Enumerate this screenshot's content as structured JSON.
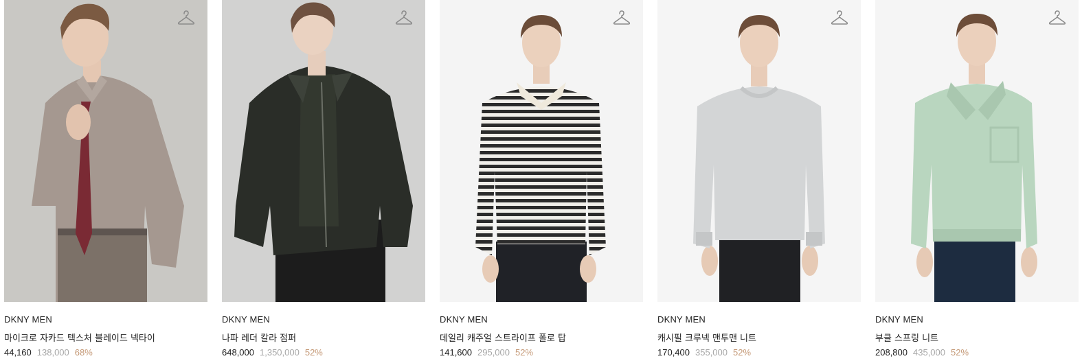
{
  "products": [
    {
      "brand": "DKNY MEN",
      "name": "마이크로 자카드 텍스처 블레이드 넥타이",
      "price": "44,160",
      "original_price": "138,000",
      "discount": "68%",
      "icon": "hanger-icon",
      "colors": {
        "background": "#c9c8c4",
        "garment": "#a59890",
        "pants": "#7c7168",
        "accent": "#7a2a34"
      }
    },
    {
      "brand": "DKNY MEN",
      "name": "나파 레더 칼라 점퍼",
      "price": "648,000",
      "original_price": "1,350,000",
      "discount": "52%",
      "icon": "hanger-icon",
      "colors": {
        "background": "#d2d2d1",
        "garment": "#2a2d28",
        "pants": "#1c1c1c",
        "accent": "#33382f"
      }
    },
    {
      "brand": "DKNY MEN",
      "name": "데일리 캐주얼 스트라이프 폴로 탑",
      "price": "141,600",
      "original_price": "295,000",
      "discount": "52%",
      "icon": "hanger-icon",
      "colors": {
        "background": "#f4f4f4",
        "garment": "#2b2b2b",
        "pants": "#202227",
        "accent": "#efe9dc"
      }
    },
    {
      "brand": "DKNY MEN",
      "name": "캐시필 크루넥 맨투맨 니트",
      "price": "170,400",
      "original_price": "355,000",
      "discount": "52%",
      "icon": "hanger-icon",
      "colors": {
        "background": "#f5f5f5",
        "garment": "#d3d5d6",
        "pants": "#202124",
        "accent": "#c4c6c7"
      }
    },
    {
      "brand": "DKNY MEN",
      "name": "부클 스프링 니트",
      "price": "208,800",
      "original_price": "435,000",
      "discount": "52%",
      "icon": "hanger-icon",
      "colors": {
        "background": "#f5f5f5",
        "garment": "#b9d6bf",
        "pants": "#1d2c40",
        "accent": "#a9c7af"
      }
    }
  ]
}
